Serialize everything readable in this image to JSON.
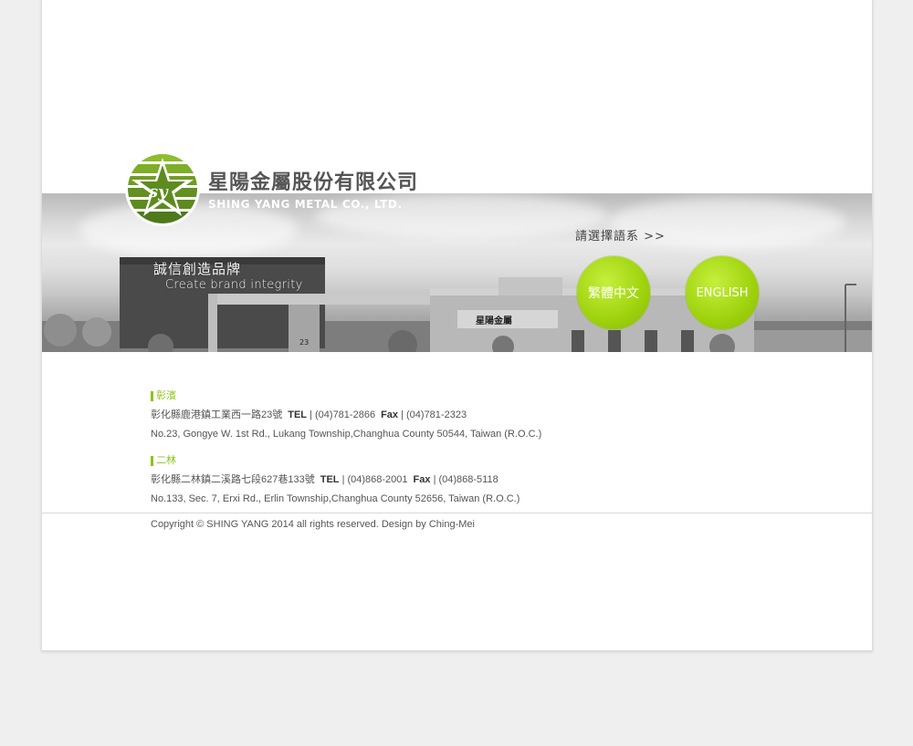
{
  "company": {
    "name_zh": "星陽金屬股份有限公司",
    "name_en": "SHING YANG METAL CO., LTD.",
    "logo_monogram": "sy"
  },
  "banner": {
    "slogan_zh": "誠信創造品牌",
    "slogan_en": "Create brand integrity",
    "building_sign": "星陽金屬",
    "building_number": "23",
    "language_prompt": "請選擇語系 >>"
  },
  "languages": {
    "zh_label": "繁體中文",
    "en_label": "ENGLISH"
  },
  "locations": [
    {
      "name": "彰濱",
      "address_zh": "彰化縣鹿港鎮工業西一路23號",
      "tel_label": "TEL",
      "tel": "| (04)781-2866",
      "fax_label": "Fax",
      "fax": "| (04)781-2323",
      "address_en": "No.23, Gongye W. 1st Rd., Lukang Township,Changhua County 50544, Taiwan (R.O.C.)"
    },
    {
      "name": "二林",
      "address_zh": "彰化縣二林鎮二溪路七段627巷133號",
      "tel_label": "TEL",
      "tel": "| (04)868-2001",
      "fax_label": "Fax",
      "fax": "| (04)868-5118",
      "address_en": "No.133, Sec. 7, Erxi Rd., Erlin Township,Changhua County 52656, Taiwan (R.O.C.)"
    }
  ],
  "footer": {
    "copyright": "Copyright © SHING YANG 2014 all rights reserved. Design by Ching-Mei"
  },
  "colors": {
    "accent": "#9ed20d",
    "accent_text": "#8cc414",
    "logo_green": "#6d9a2a",
    "page_bg": "#efefef"
  }
}
